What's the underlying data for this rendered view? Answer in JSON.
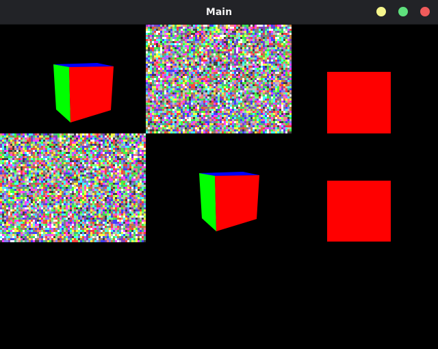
{
  "window": {
    "title": "Main",
    "controls": [
      {
        "name": "minimize-button",
        "color": "#f5f58c"
      },
      {
        "name": "maximize-button",
        "color": "#5fe07d"
      },
      {
        "name": "close-button",
        "color": "#f05b5b"
      }
    ]
  },
  "scene": {
    "background_color": "#000000",
    "cube_colors": {
      "front": "#ff0000",
      "left": "#00ff00",
      "top": "#0000ff"
    },
    "square_color": "#ff0000",
    "noise_palette": [
      "#ff4040",
      "#40ff40",
      "#4040ff",
      "#ffff40",
      "#ff40ff",
      "#40ffff",
      "#ffffff",
      "#808080",
      "#c08040",
      "#40c080",
      "#8040c0",
      "#404040",
      "#c0c0c0",
      "#ff8080",
      "#80ff80",
      "#8080ff"
    ]
  }
}
